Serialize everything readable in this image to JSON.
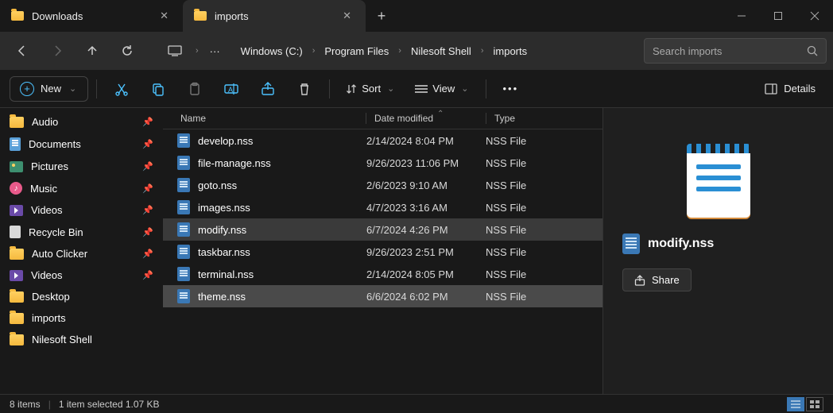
{
  "tabs": [
    {
      "label": "Downloads"
    },
    {
      "label": "imports"
    }
  ],
  "breadcrumb": {
    "items": [
      "Windows (C:)",
      "Program Files",
      "Nilesoft Shell",
      "imports"
    ]
  },
  "search": {
    "placeholder": "Search imports"
  },
  "toolbar": {
    "new_label": "New",
    "sort_label": "Sort",
    "view_label": "View",
    "details_label": "Details"
  },
  "sidebar": {
    "items": [
      {
        "label": "Audio",
        "icon": "folder",
        "pinned": true
      },
      {
        "label": "Documents",
        "icon": "doc",
        "pinned": true
      },
      {
        "label": "Pictures",
        "icon": "pic",
        "pinned": true
      },
      {
        "label": "Music",
        "icon": "music",
        "pinned": true
      },
      {
        "label": "Videos",
        "icon": "video",
        "pinned": true
      },
      {
        "label": "Recycle Bin",
        "icon": "bin",
        "pinned": true
      },
      {
        "label": "Auto Clicker",
        "icon": "folder",
        "pinned": true
      },
      {
        "label": "Videos",
        "icon": "video",
        "pinned": true
      },
      {
        "label": "Desktop",
        "icon": "folder",
        "pinned": false
      },
      {
        "label": "imports",
        "icon": "folder",
        "pinned": false
      },
      {
        "label": "Nilesoft Shell",
        "icon": "folder",
        "pinned": false
      }
    ]
  },
  "columns": {
    "name": "Name",
    "date": "Date modified",
    "type": "Type"
  },
  "files": [
    {
      "name": "develop.nss",
      "date": "2/14/2024 8:04 PM",
      "type": "NSS File",
      "state": ""
    },
    {
      "name": "file-manage.nss",
      "date": "9/26/2023 11:06 PM",
      "type": "NSS File",
      "state": ""
    },
    {
      "name": "goto.nss",
      "date": "2/6/2023 9:10 AM",
      "type": "NSS File",
      "state": ""
    },
    {
      "name": "images.nss",
      "date": "4/7/2023 3:16 AM",
      "type": "NSS File",
      "state": ""
    },
    {
      "name": "modify.nss",
      "date": "6/7/2024 4:26 PM",
      "type": "NSS File",
      "state": "selected"
    },
    {
      "name": "taskbar.nss",
      "date": "9/26/2023 2:51 PM",
      "type": "NSS File",
      "state": ""
    },
    {
      "name": "terminal.nss",
      "date": "2/14/2024 8:05 PM",
      "type": "NSS File",
      "state": ""
    },
    {
      "name": "theme.nss",
      "date": "6/6/2024 6:02 PM",
      "type": "NSS File",
      "state": "hl"
    }
  ],
  "preview": {
    "filename": "modify.nss",
    "share_label": "Share"
  },
  "status": {
    "count": "8 items",
    "selection": "1 item selected  1.07 KB"
  }
}
